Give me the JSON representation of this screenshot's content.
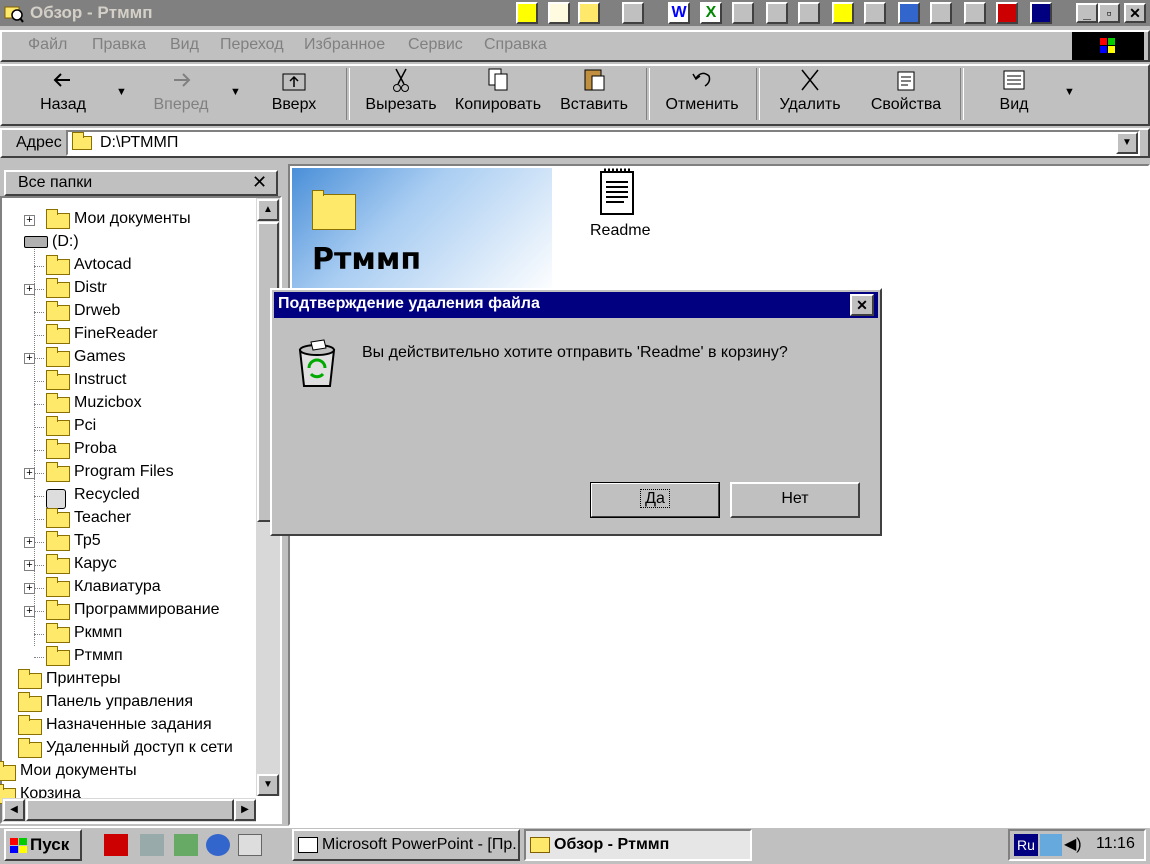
{
  "window": {
    "title": "Обзор - Ртммп"
  },
  "menu": {
    "items": [
      "Файл",
      "Правка",
      "Вид",
      "Переход",
      "Избранное",
      "Сервис",
      "Справка"
    ]
  },
  "toolbar": {
    "back": "Назад",
    "forward": "Вперед",
    "up": "Вверх",
    "cut": "Вырезать",
    "copy": "Копировать",
    "paste": "Вставить",
    "undo": "Отменить",
    "delete": "Удалить",
    "properties": "Свойства",
    "view": "Вид"
  },
  "address": {
    "label": "Адрес",
    "value": "D:\\РТММП"
  },
  "tree": {
    "header": "Все папки",
    "items": [
      "Мои документы",
      "(D:)",
      "Avtocad",
      "Distr",
      "Drweb",
      "FineReader",
      "Games",
      "Instruct",
      "Muzicbox",
      "Pci",
      "Proba",
      "Program Files",
      "Recycled",
      "Teacher",
      "Тр5",
      "Карус",
      "Клавиатура",
      "Программирование",
      "Ркммп",
      "Ртммп",
      "Принтеры",
      "Панель управления",
      "Назначенные задания",
      "Удаленный доступ к сети",
      "Мои документы",
      "Корзина"
    ]
  },
  "content": {
    "folder_title": "Ртммп",
    "file": "Readme"
  },
  "dialog": {
    "title": "Подтверждение удаления файла",
    "message": "Вы действительно хотите отправить 'Readme' в корзину?",
    "yes": "Да",
    "no": "Нет"
  },
  "taskbar": {
    "start": "Пуск",
    "task1": "Microsoft PowerPoint - [Пр...",
    "task2": "Обзор - Ртммп",
    "lang": "Ru",
    "clock": "11:16"
  },
  "colors": {
    "dialog_title": "#000080",
    "desktop_gray": "#c0c0c0"
  }
}
